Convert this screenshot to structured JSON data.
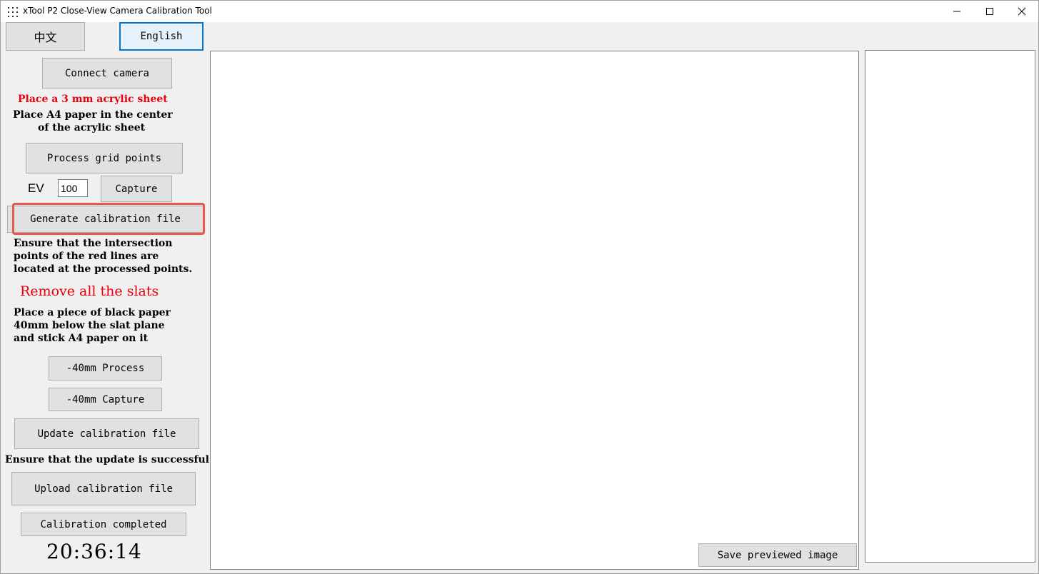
{
  "window": {
    "title": "xTool P2 Close-View Camera Calibration Tool"
  },
  "icons": {
    "app": "app-dots-icon",
    "minimize": "minimize-icon",
    "maximize": "maximize-icon",
    "close": "close-icon"
  },
  "language": {
    "chinese_label": "中文",
    "english_label": "English",
    "selected": "English"
  },
  "steps": {
    "connect_camera": "Connect camera",
    "acrylic_notice": "Place a 3 mm acrylic sheet",
    "paper_instruction_line1": "Place A4 paper in the center",
    "paper_instruction_line2": "of the acrylic sheet",
    "process_grid_points": "Process grid points",
    "ev_label": "EV",
    "ev_value": "100",
    "capture": "Capture",
    "generate_calibration_file": "Generate calibration file",
    "ensure_line1": "Ensure that the intersection",
    "ensure_line2": "points of the red lines are",
    "ensure_line3": "located at the processed points.",
    "remove_slats": "Remove all the slats",
    "black_paper_line1": "Place a piece of black paper",
    "black_paper_line2": "40mm below the slat plane",
    "black_paper_line3": "and stick A4 paper on it",
    "minus40_process": "-40mm Process",
    "minus40_capture": "-40mm Capture",
    "update_calibration_file": "Update calibration file",
    "ensure_update": "Ensure that the update is successful",
    "upload_calibration_file": "Upload calibration file",
    "calibration_completed": "Calibration completed",
    "clock": "20:36:14"
  },
  "preview": {
    "save_previewed_image": "Save previewed image"
  },
  "colors": {
    "accent": "#0078d7",
    "highlight": "#e8584f",
    "warning_text": "#e8000b"
  }
}
